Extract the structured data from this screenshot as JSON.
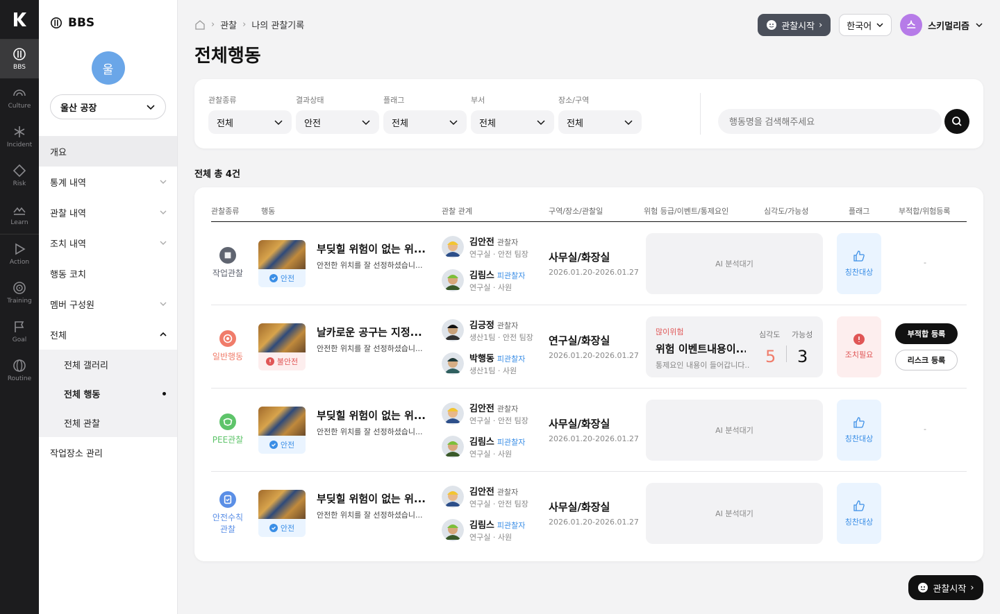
{
  "rail": [
    {
      "label": "BBS",
      "icon": "bbs-icon",
      "active": true
    },
    {
      "label": "Culture",
      "icon": "culture-icon"
    },
    {
      "label": "Incident",
      "icon": "incident-icon"
    },
    {
      "label": "Risk",
      "icon": "risk-icon"
    },
    {
      "label": "Learn",
      "icon": "learn-icon"
    },
    {
      "label": "Action",
      "icon": "action-icon"
    },
    {
      "label": "Training",
      "icon": "training-icon"
    },
    {
      "label": "Goal",
      "icon": "goal-icon"
    },
    {
      "label": "Routine",
      "icon": "routine-icon"
    }
  ],
  "sidebar": {
    "brand": "BBS",
    "avatar_initial": "울",
    "site": "울산 공장",
    "items": [
      {
        "label": "개요",
        "active": true
      },
      {
        "label": "통계 내역",
        "chevron": true
      },
      {
        "label": "관찰 내역",
        "chevron": true
      },
      {
        "label": "조치 내역",
        "chevron": true
      },
      {
        "label": "행동 코치"
      },
      {
        "label": "멤버 구성원",
        "chevron": true
      },
      {
        "label": "전체",
        "expanded": true
      }
    ],
    "sub_items": [
      {
        "label": "전체 갤러리"
      },
      {
        "label": "전체 행동",
        "current": true
      },
      {
        "label": "전체 관찰"
      }
    ],
    "bottom_item": "작업장소 관리"
  },
  "breadcrumb": [
    "관찰",
    "나의 관찰기록"
  ],
  "page_title": "전체행동",
  "topbar": {
    "observe_label": "관찰시작",
    "language": "한국어",
    "user_initial": "스",
    "user_name": "스키멀리즘"
  },
  "filters": [
    {
      "label": "관찰종류",
      "value": "전체"
    },
    {
      "label": "결과상태",
      "value": "안전"
    },
    {
      "label": "플래그",
      "value": "전체"
    },
    {
      "label": "부서",
      "value": "전체"
    },
    {
      "label": "장소/구역",
      "value": "전체"
    }
  ],
  "search": {
    "placeholder": "행동명을 검색해주세요"
  },
  "count_text": "전체 총 4건",
  "table": {
    "headers": [
      "관찰종류",
      "행동",
      "관찰 관계",
      "구역/장소/관찰일",
      "위험 등급/이벤트/통제요인",
      "심각도/가능성",
      "플래그",
      "부적합/위험등록"
    ],
    "rows": [
      {
        "category": "작업관찰",
        "category_color": "#5f6470",
        "status": "안전",
        "status_color": "#3a8ee6",
        "title": "부딪힐 위험이 없는 위...",
        "desc": "안전한 위치를 잘 선정하셨습니...",
        "observer": {
          "name": "김안전",
          "role": "관찰자",
          "dept": "연구실 · 안전 팀장"
        },
        "observee": {
          "name": "김림스",
          "role": "피관찰자",
          "dept": "연구실 · 사원"
        },
        "location": "사무실/화장실",
        "dates": "2026.01.20-2026.01.27",
        "risk_text": "AI 분석대기",
        "flag": "칭찬대상",
        "flag_type": "praise",
        "registration": "-"
      },
      {
        "category": "일반행동",
        "category_color": "#f07c6a",
        "status": "불안전",
        "status_color": "#e05656",
        "title": "날카로운 공구는 지정...",
        "desc": "안전한 위치를 잘 선정하셨습니...",
        "observer": {
          "name": "김긍정",
          "role": "관찰자",
          "dept": "생산1팀 · 안전 팀장"
        },
        "observee": {
          "name": "박행동",
          "role": "피관찰자",
          "dept": "생산1팀 · 사원"
        },
        "location": "연구실/화장실",
        "dates": "2026.01.20-2026.01.27",
        "risk_level": "많이위험",
        "risk_event": "위험 이벤트내용이...",
        "risk_control": "통제요인 내용이 들어갑니다...",
        "severity_label": "심각도",
        "severity": "5",
        "likelihood_label": "가능성",
        "likelihood": "3",
        "flag": "조치필요",
        "flag_type": "action",
        "btn_nonconform": "부적합 등록",
        "btn_risk": "리스크 등록"
      },
      {
        "category": "PEE관찰",
        "category_color": "#5ec46a",
        "status": "안전",
        "status_color": "#3a8ee6",
        "title": "부딪힐 위험이 없는 위...",
        "desc": "안전한 위치를 잘 선정하셨습니...",
        "observer": {
          "name": "김안전",
          "role": "관찰자",
          "dept": "연구실 · 안전 팀장"
        },
        "observee": {
          "name": "김림스",
          "role": "피관찰자",
          "dept": "연구실 · 사원"
        },
        "location": "사무실/화장실",
        "dates": "2026.01.20-2026.01.27",
        "risk_text": "AI 분석대기",
        "flag": "칭찬대상",
        "flag_type": "praise",
        "registration": "-"
      },
      {
        "category": "안전수칙 관찰",
        "category_color": "#5b8fe6",
        "status": "안전",
        "status_color": "#3a8ee6",
        "title": "부딪힐 위험이 없는 위...",
        "desc": "안전한 위치를 잘 선정하셨습니...",
        "observer": {
          "name": "김안전",
          "role": "관찰자",
          "dept": "연구실 · 안전 팀장"
        },
        "observee": {
          "name": "김림스",
          "role": "피관찰자",
          "dept": "연구실 · 사원"
        },
        "location": "사무실/화장실",
        "dates": "2026.01.20-2026.01.27",
        "risk_text": "AI 분석대기",
        "flag": "칭찬대상",
        "flag_type": "praise",
        "registration": ""
      }
    ]
  },
  "float_button": "관찰시작"
}
